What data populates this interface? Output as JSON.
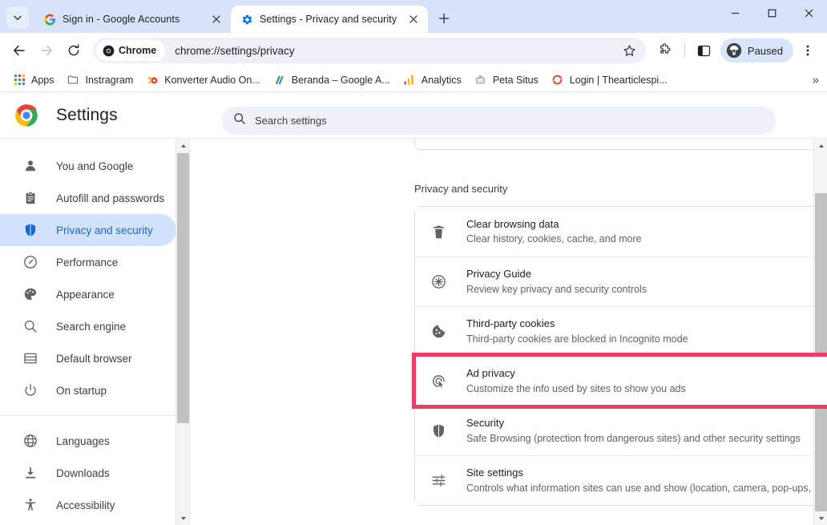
{
  "window": {
    "controls": {
      "minimize": "minimize-button",
      "maximize": "maximize-button",
      "close": "close-button"
    }
  },
  "tabs": {
    "tab_search_label": "tab-search",
    "new_tab_label": "New tab",
    "items": [
      {
        "title": "Sign in - Google Accounts",
        "favicon": "google-icon",
        "active": false
      },
      {
        "title": "Settings - Privacy and security",
        "favicon": "gear-icon",
        "active": true
      }
    ]
  },
  "toolbar": {
    "back_label": "Back",
    "forward_label": "Forward",
    "reload_label": "Reload",
    "chrome_chip_label": "Chrome",
    "url": "chrome://settings/privacy",
    "bookmark_label": "Bookmark this tab",
    "extensions_label": "Extensions",
    "side_panel_label": "Side panel",
    "profile_label": "Paused",
    "menu_label": "Customize and control Google Chrome"
  },
  "bookmarks": {
    "items": [
      {
        "label": "Apps",
        "icon": "apps-grid-icon"
      },
      {
        "label": "Instragram",
        "icon": "folder-icon"
      },
      {
        "label": "Konverter Audio On...",
        "icon": "konverter-icon"
      },
      {
        "label": "Beranda – Google A...",
        "icon": "google-ads-icon"
      },
      {
        "label": "Analytics",
        "icon": "analytics-icon"
      },
      {
        "label": "Peta Situs",
        "icon": "sitemap-icon"
      },
      {
        "label": "Login | Thearticlespi...",
        "icon": "refresh-red-icon"
      }
    ],
    "overflow_label": "»"
  },
  "settings_header": {
    "title": "Settings",
    "logo": "chrome-logo-icon"
  },
  "search": {
    "placeholder": "Search settings",
    "icon": "search-icon",
    "value": ""
  },
  "sidebar": {
    "groups": [
      {
        "items": [
          {
            "label": "You and Google",
            "icon": "person-icon",
            "active": false
          },
          {
            "label": "Autofill and passwords",
            "icon": "clipboard-icon",
            "active": false
          },
          {
            "label": "Privacy and security",
            "icon": "shield-icon",
            "active": true
          },
          {
            "label": "Performance",
            "icon": "speedometer-icon",
            "active": false
          },
          {
            "label": "Appearance",
            "icon": "palette-icon",
            "active": false
          },
          {
            "label": "Search engine",
            "icon": "search-icon",
            "active": false
          },
          {
            "label": "Default browser",
            "icon": "browser-window-icon",
            "active": false
          },
          {
            "label": "On startup",
            "icon": "power-icon",
            "active": false
          }
        ]
      },
      {
        "items": [
          {
            "label": "Languages",
            "icon": "globe-icon",
            "active": false
          },
          {
            "label": "Downloads",
            "icon": "download-icon",
            "active": false
          },
          {
            "label": "Accessibility",
            "icon": "accessibility-icon",
            "active": false
          }
        ]
      }
    ]
  },
  "main": {
    "section_title": "Privacy and security",
    "highlight_color": "#ef3a66",
    "rows": [
      {
        "title": "Clear browsing data",
        "subtitle": "Clear history, cookies, cache, and more",
        "icon": "trash-icon",
        "highlighted": false
      },
      {
        "title": "Privacy Guide",
        "subtitle": "Review key privacy and security controls",
        "icon": "privacy-guide-icon",
        "highlighted": false
      },
      {
        "title": "Third-party cookies",
        "subtitle": "Third-party cookies are blocked in Incognito mode",
        "icon": "cookie-icon",
        "highlighted": false
      },
      {
        "title": "Ad privacy",
        "subtitle": "Customize the info used by sites to show you ads",
        "icon": "ad-privacy-icon",
        "highlighted": true
      },
      {
        "title": "Security",
        "subtitle": "Safe Browsing (protection from dangerous sites) and other security settings",
        "icon": "shield-icon",
        "highlighted": false
      },
      {
        "title": "Site settings",
        "subtitle": "Controls what information sites can use and show (location, camera, pop-ups, and more)",
        "icon": "sliders-icon",
        "highlighted": false
      }
    ]
  },
  "scrollbars": {
    "sidebar_label": "sidebar-scrollbar",
    "main_label": "main-scrollbar",
    "up_arrow": "▲",
    "down_arrow": "▼"
  }
}
